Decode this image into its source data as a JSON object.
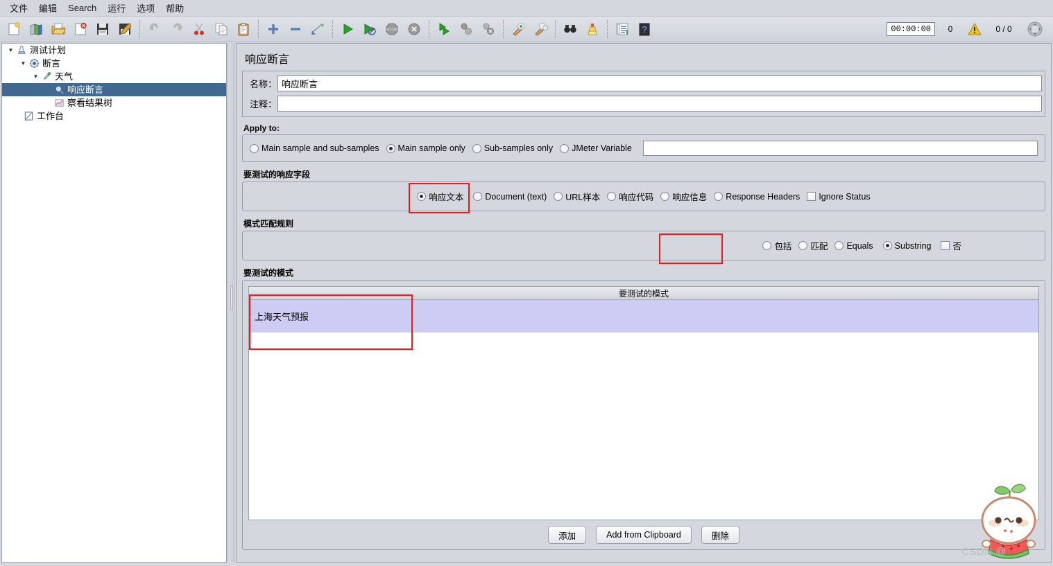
{
  "menubar": {
    "items": [
      {
        "label": "文件",
        "name": "menu-file"
      },
      {
        "label": "编辑",
        "name": "menu-edit"
      },
      {
        "label": "Search",
        "name": "menu-search"
      },
      {
        "label": "运行",
        "name": "menu-run"
      },
      {
        "label": "选项",
        "name": "menu-options"
      },
      {
        "label": "帮助",
        "name": "menu-help"
      }
    ]
  },
  "toolbar": {
    "icons": [
      "new-test-plan-icon",
      "open-templates-icon",
      "open-file-icon",
      "close-file-icon",
      "save-icon",
      "save-as-icon",
      "undo-icon",
      "redo-icon",
      "cut-icon",
      "copy-icon",
      "paste-icon",
      "expand-icon",
      "collapse-icon",
      "toggle-icon",
      "start-icon",
      "start-no-pauses-icon",
      "stop-icon",
      "shutdown-icon",
      "start-remote-icon",
      "stop-remote-icon",
      "shutdown-remote-icon",
      "clear-icon",
      "clear-all-icon",
      "search-icon",
      "reset-search-icon",
      "function-helper-icon",
      "help-icon"
    ],
    "timer": "00:00:00",
    "warning_count": "0",
    "warning_icon": "warning-triangle-icon",
    "thread_count": "0 / 0",
    "status_icon": "remote-status-icon"
  },
  "tree": {
    "nodes": [
      {
        "label": "测试计划",
        "icon": "test-plan-icon",
        "depth": 0,
        "twisty": "▼",
        "selected": false
      },
      {
        "label": "断言",
        "icon": "thread-group-icon",
        "depth": 1,
        "twisty": "▼",
        "selected": false
      },
      {
        "label": "天气",
        "icon": "http-request-icon",
        "depth": 2,
        "twisty": "▼",
        "selected": false
      },
      {
        "label": "响应断言",
        "icon": "response-assertion-icon",
        "depth": 3,
        "twisty": "",
        "selected": true
      },
      {
        "label": "察看结果树",
        "icon": "view-results-tree-icon",
        "depth": 3,
        "twisty": "",
        "selected": false
      },
      {
        "label": "工作台",
        "icon": "workbench-icon",
        "depth": 0,
        "twisty": "",
        "selected": false
      }
    ]
  },
  "panel": {
    "title": "响应断言",
    "name_label": "名称：",
    "name_value": "响应断言",
    "comment_label": "注释：",
    "comment_value": "",
    "comment_placeholder": ""
  },
  "apply_to": {
    "title": "Apply to:",
    "options": [
      {
        "label": "Main sample and sub-samples",
        "selected": false
      },
      {
        "label": "Main sample only",
        "selected": true
      },
      {
        "label": "Sub-samples only",
        "selected": false
      },
      {
        "label": "JMeter Variable",
        "selected": false
      }
    ],
    "variable_value": "",
    "variable_placeholder": ""
  },
  "response_field": {
    "title": "要测试的响应字段",
    "options": [
      {
        "label": "响应文本",
        "type": "radio",
        "selected": true,
        "highlighted": true
      },
      {
        "label": "Document (text)",
        "type": "radio",
        "selected": false
      },
      {
        "label": "URL样本",
        "type": "radio",
        "selected": false
      },
      {
        "label": "响应代码",
        "type": "radio",
        "selected": false
      },
      {
        "label": "响应信息",
        "type": "radio",
        "selected": false
      },
      {
        "label": "Response Headers",
        "type": "radio",
        "selected": false
      },
      {
        "label": "Ignore Status",
        "type": "checkbox",
        "checked": false
      }
    ]
  },
  "pattern_rules": {
    "title": "模式匹配规则",
    "options": [
      {
        "label": "包括",
        "type": "radio",
        "selected": false
      },
      {
        "label": "匹配",
        "type": "radio",
        "selected": false
      },
      {
        "label": "Equals",
        "type": "radio",
        "selected": false
      },
      {
        "label": "Substring",
        "type": "radio",
        "selected": true,
        "highlighted": true
      },
      {
        "label": "否",
        "type": "checkbox",
        "checked": false
      }
    ]
  },
  "patterns": {
    "title": "要测试的模式",
    "column_header": "要测试的模式",
    "rows": [
      {
        "value": "上海天气预报",
        "selected": true,
        "highlighted": true
      }
    ],
    "buttons": [
      {
        "label": "添加",
        "name": "add-pattern-button"
      },
      {
        "label": "Add from Clipboard",
        "name": "add-from-clipboard-button"
      },
      {
        "label": "删除",
        "name": "delete-pattern-button"
      }
    ]
  },
  "watermark": {
    "text": "CSDN @",
    "mascot": "watermelon-mascot-icon"
  },
  "colors": {
    "accent_selection": "#41688f",
    "table_row_selected": "#ccccf5",
    "highlight_red": "#ef1a1a",
    "panel_bg": "#d4d7de"
  }
}
